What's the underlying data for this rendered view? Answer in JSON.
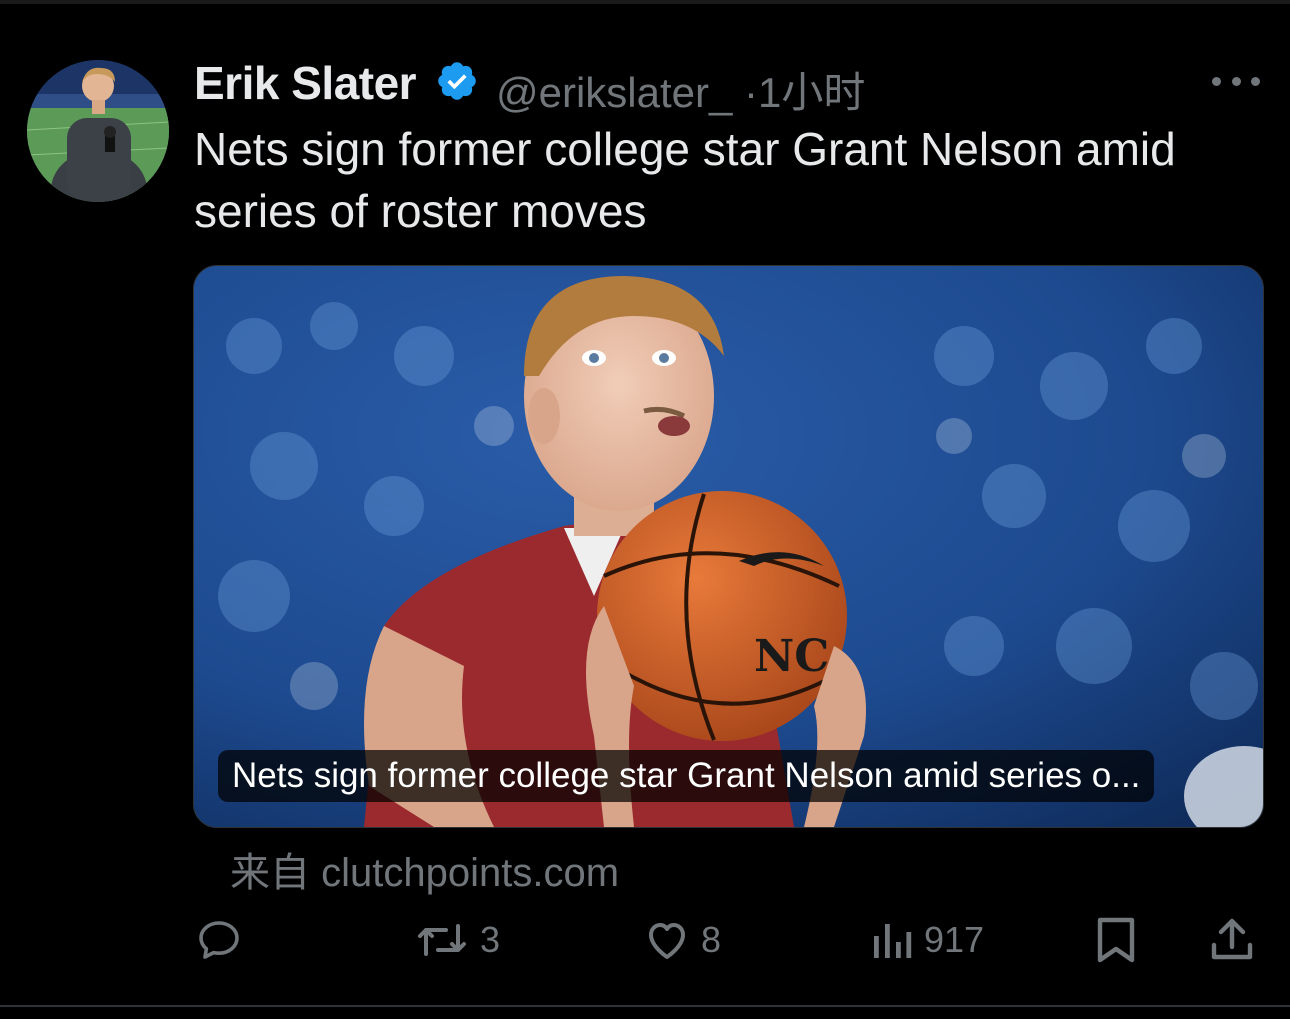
{
  "tweet": {
    "author_name": "Erik Slater",
    "verified": true,
    "handle": "@erikslater_",
    "separator": "·",
    "time": "1小时",
    "text": "Nets sign former college star Grant Nelson amid series of roster moves",
    "more_icon": "more-horizontal-icon"
  },
  "card": {
    "caption": "Nets sign former college star Grant Nelson amid series o...",
    "source": "来自 clutchpoints.com"
  },
  "actions": {
    "reply": {
      "icon": "reply-bubble-icon",
      "count": ""
    },
    "retweet": {
      "icon": "retweet-icon",
      "count": "3"
    },
    "like": {
      "icon": "heart-icon",
      "count": "8"
    },
    "views": {
      "icon": "views-bar-icon",
      "count": "917"
    },
    "bookmark": {
      "icon": "bookmark-icon"
    },
    "share": {
      "icon": "share-icon"
    }
  },
  "colors": {
    "background": "#000000",
    "primary_text": "#e7e9ea",
    "secondary_text": "#71767b",
    "verified_blue": "#1d9bf0",
    "border": "#2f3336"
  }
}
